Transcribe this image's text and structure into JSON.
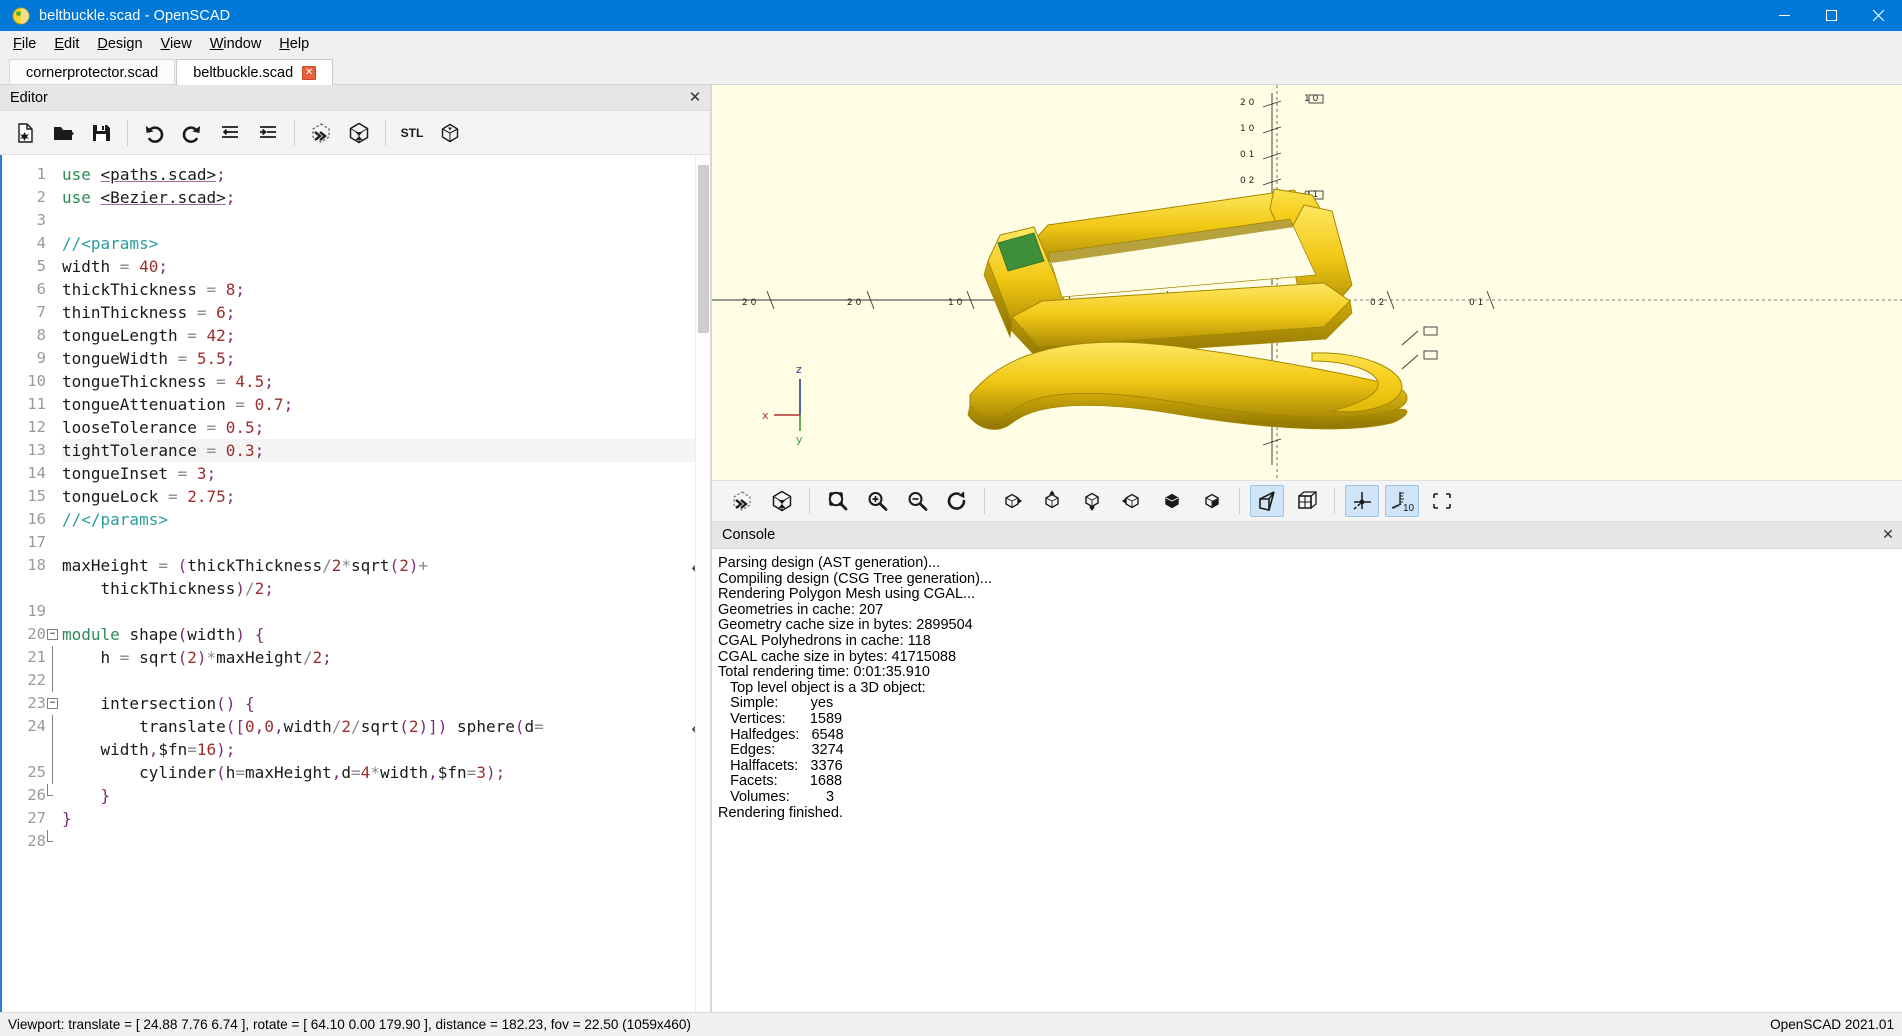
{
  "window": {
    "title": "beltbuckle.scad - OpenSCAD",
    "app_icon": "openscad-logo-icon",
    "titlebar_color": "#0078d7",
    "minimize_label": "Minimize",
    "maximize_label": "Maximize",
    "close_label": "Close"
  },
  "menubar": {
    "items": [
      {
        "label": "File",
        "mnemonic": "F"
      },
      {
        "label": "Edit",
        "mnemonic": "E"
      },
      {
        "label": "Design",
        "mnemonic": "D"
      },
      {
        "label": "View",
        "mnemonic": "V"
      },
      {
        "label": "Window",
        "mnemonic": "W"
      },
      {
        "label": "Help",
        "mnemonic": "H"
      }
    ]
  },
  "doctabs": {
    "tabs": [
      {
        "label": "cornerprotector.scad",
        "active": false,
        "closable": false
      },
      {
        "label": "beltbuckle.scad",
        "active": true,
        "closable": true,
        "close_glyph": "✕"
      }
    ]
  },
  "editor": {
    "dock_title": "Editor",
    "dock_close_glyph": "✕",
    "toolbar": [
      {
        "name": "new-document-button",
        "icon": "new-file-icon",
        "title": "New"
      },
      {
        "name": "open-document-button",
        "icon": "open-folder-icon",
        "title": "Open"
      },
      {
        "name": "save-document-button",
        "icon": "floppy-save-icon",
        "title": "Save"
      },
      {
        "name": "separator-1",
        "icon": "separator",
        "title": ""
      },
      {
        "name": "undo-button",
        "icon": "undo-arrow-icon",
        "title": "Undo"
      },
      {
        "name": "redo-button",
        "icon": "redo-arrow-icon",
        "title": "Redo"
      },
      {
        "name": "unindent-button",
        "icon": "unindent-icon",
        "title": "Unindent"
      },
      {
        "name": "indent-button",
        "icon": "indent-icon",
        "title": "Indent"
      },
      {
        "name": "separator-2",
        "icon": "separator",
        "title": ""
      },
      {
        "name": "preview-button",
        "icon": "preview-fast-icon",
        "title": "Preview"
      },
      {
        "name": "render-button",
        "icon": "render-cube-icon",
        "title": "Render"
      },
      {
        "name": "separator-3",
        "icon": "separator",
        "title": ""
      },
      {
        "name": "export-stl-button",
        "icon": "stl-export-icon",
        "title": "Export as STL",
        "text": "STL"
      },
      {
        "name": "export-amf-button",
        "icon": "amf-export-icon",
        "title": "Export as AMF"
      }
    ],
    "scrollbar": {
      "name": "editor-vertical-scrollbar"
    },
    "current_line": 13,
    "lines": [
      {
        "n": 1,
        "fold": "",
        "tokens": [
          {
            "t": "use",
            "c": "k-use"
          },
          {
            "t": " ",
            "c": "k-id"
          },
          {
            "t": "<paths.scad>",
            "c": "k-inc"
          },
          {
            "t": ";",
            "c": "k-punc"
          }
        ]
      },
      {
        "n": 2,
        "fold": "",
        "tokens": [
          {
            "t": "use",
            "c": "k-use"
          },
          {
            "t": " ",
            "c": "k-id"
          },
          {
            "t": "<Bezier.scad>",
            "c": "k-inc"
          },
          {
            "t": ";",
            "c": "k-punc"
          }
        ]
      },
      {
        "n": 3,
        "fold": "",
        "tokens": []
      },
      {
        "n": 4,
        "fold": "",
        "tokens": [
          {
            "t": "//<params>",
            "c": "k-com"
          }
        ]
      },
      {
        "n": 5,
        "fold": "",
        "tokens": [
          {
            "t": "width ",
            "c": "k-id"
          },
          {
            "t": "= ",
            "c": "k-op"
          },
          {
            "t": "40",
            "c": "k-num"
          },
          {
            "t": ";",
            "c": "k-punc"
          }
        ]
      },
      {
        "n": 6,
        "fold": "",
        "tokens": [
          {
            "t": "thickThickness ",
            "c": "k-id"
          },
          {
            "t": "= ",
            "c": "k-op"
          },
          {
            "t": "8",
            "c": "k-num"
          },
          {
            "t": ";",
            "c": "k-punc"
          }
        ]
      },
      {
        "n": 7,
        "fold": "",
        "tokens": [
          {
            "t": "thinThickness ",
            "c": "k-id"
          },
          {
            "t": "= ",
            "c": "k-op"
          },
          {
            "t": "6",
            "c": "k-num"
          },
          {
            "t": ";",
            "c": "k-punc"
          }
        ]
      },
      {
        "n": 8,
        "fold": "",
        "tokens": [
          {
            "t": "tongueLength ",
            "c": "k-id"
          },
          {
            "t": "= ",
            "c": "k-op"
          },
          {
            "t": "42",
            "c": "k-num"
          },
          {
            "t": ";",
            "c": "k-punc"
          }
        ]
      },
      {
        "n": 9,
        "fold": "",
        "tokens": [
          {
            "t": "tongueWidth ",
            "c": "k-id"
          },
          {
            "t": "= ",
            "c": "k-op"
          },
          {
            "t": "5.5",
            "c": "k-num"
          },
          {
            "t": ";",
            "c": "k-punc"
          }
        ]
      },
      {
        "n": 10,
        "fold": "",
        "tokens": [
          {
            "t": "tongueThickness ",
            "c": "k-id"
          },
          {
            "t": "= ",
            "c": "k-op"
          },
          {
            "t": "4.5",
            "c": "k-num"
          },
          {
            "t": ";",
            "c": "k-punc"
          }
        ]
      },
      {
        "n": 11,
        "fold": "",
        "tokens": [
          {
            "t": "tongueAttenuation ",
            "c": "k-id"
          },
          {
            "t": "= ",
            "c": "k-op"
          },
          {
            "t": "0.7",
            "c": "k-num"
          },
          {
            "t": ";",
            "c": "k-punc"
          }
        ]
      },
      {
        "n": 12,
        "fold": "",
        "tokens": [
          {
            "t": "looseTolerance ",
            "c": "k-id"
          },
          {
            "t": "= ",
            "c": "k-op"
          },
          {
            "t": "0.5",
            "c": "k-num"
          },
          {
            "t": ";",
            "c": "k-punc"
          }
        ]
      },
      {
        "n": 13,
        "fold": "",
        "tokens": [
          {
            "t": "tightTolerance ",
            "c": "k-id"
          },
          {
            "t": "= ",
            "c": "k-op"
          },
          {
            "t": "0.3",
            "c": "k-num"
          },
          {
            "t": ";",
            "c": "k-punc"
          }
        ]
      },
      {
        "n": 14,
        "fold": "",
        "tokens": [
          {
            "t": "tongueInset ",
            "c": "k-id"
          },
          {
            "t": "= ",
            "c": "k-op"
          },
          {
            "t": "3",
            "c": "k-num"
          },
          {
            "t": ";",
            "c": "k-punc"
          }
        ]
      },
      {
        "n": 15,
        "fold": "",
        "tokens": [
          {
            "t": "tongueLock ",
            "c": "k-id"
          },
          {
            "t": "= ",
            "c": "k-op"
          },
          {
            "t": "2.75",
            "c": "k-num"
          },
          {
            "t": ";",
            "c": "k-punc"
          }
        ]
      },
      {
        "n": 16,
        "fold": "",
        "tokens": [
          {
            "t": "//</params>",
            "c": "k-com"
          }
        ]
      },
      {
        "n": 17,
        "fold": "",
        "tokens": []
      },
      {
        "n": 18,
        "fold": "",
        "wrap": true,
        "tokens": [
          {
            "t": "maxHeight ",
            "c": "k-id"
          },
          {
            "t": "= ",
            "c": "k-op"
          },
          {
            "t": "(",
            "c": "k-punc"
          },
          {
            "t": "thickThickness",
            "c": "k-id"
          },
          {
            "t": "/",
            "c": "k-op"
          },
          {
            "t": "2",
            "c": "k-num"
          },
          {
            "t": "*",
            "c": "k-op"
          },
          {
            "t": "sqrt",
            "c": "k-id"
          },
          {
            "t": "(",
            "c": "k-punc"
          },
          {
            "t": "2",
            "c": "k-num"
          },
          {
            "t": ")",
            "c": "k-punc"
          },
          {
            "t": "+",
            "c": "k-op"
          }
        ]
      },
      {
        "n": "",
        "fold": "",
        "cont": true,
        "tokens": [
          {
            "t": "    ",
            "c": "k-id"
          },
          {
            "t": "thickThickness",
            "c": "k-id"
          },
          {
            "t": ")",
            "c": "k-punc"
          },
          {
            "t": "/",
            "c": "k-op"
          },
          {
            "t": "2",
            "c": "k-num"
          },
          {
            "t": ";",
            "c": "k-punc"
          }
        ]
      },
      {
        "n": 19,
        "fold": "",
        "tokens": []
      },
      {
        "n": 20,
        "fold": "minus",
        "tokens": [
          {
            "t": "module",
            "c": "k-kw"
          },
          {
            "t": " ",
            "c": "k-id"
          },
          {
            "t": "shape",
            "c": "k-id"
          },
          {
            "t": "(",
            "c": "k-punc"
          },
          {
            "t": "width",
            "c": "k-id"
          },
          {
            "t": ")",
            "c": "k-punc"
          },
          {
            "t": " ",
            "c": "k-id"
          },
          {
            "t": "{",
            "c": "k-punc"
          }
        ]
      },
      {
        "n": 21,
        "fold": "line",
        "tokens": [
          {
            "t": "    h ",
            "c": "k-id"
          },
          {
            "t": "= ",
            "c": "k-op"
          },
          {
            "t": "sqrt",
            "c": "k-id"
          },
          {
            "t": "(",
            "c": "k-punc"
          },
          {
            "t": "2",
            "c": "k-num"
          },
          {
            "t": ")",
            "c": "k-punc"
          },
          {
            "t": "*",
            "c": "k-op"
          },
          {
            "t": "maxHeight",
            "c": "k-id"
          },
          {
            "t": "/",
            "c": "k-op"
          },
          {
            "t": "2",
            "c": "k-num"
          },
          {
            "t": ";",
            "c": "k-punc"
          }
        ]
      },
      {
        "n": 22,
        "fold": "line",
        "tokens": []
      },
      {
        "n": 23,
        "fold": "minus",
        "tokens": [
          {
            "t": "    ",
            "c": "k-id"
          },
          {
            "t": "intersection",
            "c": "k-id"
          },
          {
            "t": "()",
            "c": "k-punc"
          },
          {
            "t": " ",
            "c": "k-id"
          },
          {
            "t": "{",
            "c": "k-punc"
          }
        ]
      },
      {
        "n": 24,
        "fold": "line",
        "wrap": true,
        "tokens": [
          {
            "t": "        ",
            "c": "k-id"
          },
          {
            "t": "translate",
            "c": "k-id"
          },
          {
            "t": "([",
            "c": "k-punc"
          },
          {
            "t": "0",
            "c": "k-num"
          },
          {
            "t": ",",
            "c": "k-punc"
          },
          {
            "t": "0",
            "c": "k-num"
          },
          {
            "t": ",",
            "c": "k-punc"
          },
          {
            "t": "width",
            "c": "k-id"
          },
          {
            "t": "/",
            "c": "k-op"
          },
          {
            "t": "2",
            "c": "k-num"
          },
          {
            "t": "/",
            "c": "k-op"
          },
          {
            "t": "sqrt",
            "c": "k-id"
          },
          {
            "t": "(",
            "c": "k-punc"
          },
          {
            "t": "2",
            "c": "k-num"
          },
          {
            "t": ")])",
            "c": "k-punc"
          },
          {
            "t": " ",
            "c": "k-id"
          },
          {
            "t": "sphere",
            "c": "k-id"
          },
          {
            "t": "(",
            "c": "k-punc"
          },
          {
            "t": "d",
            "c": "k-id"
          },
          {
            "t": "=",
            "c": "k-op"
          }
        ]
      },
      {
        "n": "",
        "fold": "line",
        "cont": true,
        "tokens": [
          {
            "t": "    width",
            "c": "k-id"
          },
          {
            "t": ",",
            "c": "k-punc"
          },
          {
            "t": "$fn",
            "c": "k-id"
          },
          {
            "t": "=",
            "c": "k-op"
          },
          {
            "t": "16",
            "c": "k-num"
          },
          {
            "t": ");",
            "c": "k-punc"
          }
        ]
      },
      {
        "n": 25,
        "fold": "line",
        "tokens": [
          {
            "t": "        ",
            "c": "k-id"
          },
          {
            "t": "cylinder",
            "c": "k-id"
          },
          {
            "t": "(",
            "c": "k-punc"
          },
          {
            "t": "h",
            "c": "k-id"
          },
          {
            "t": "=",
            "c": "k-op"
          },
          {
            "t": "maxHeight",
            "c": "k-id"
          },
          {
            "t": ",",
            "c": "k-punc"
          },
          {
            "t": "d",
            "c": "k-id"
          },
          {
            "t": "=",
            "c": "k-op"
          },
          {
            "t": "4",
            "c": "k-num"
          },
          {
            "t": "*",
            "c": "k-op"
          },
          {
            "t": "width",
            "c": "k-id"
          },
          {
            "t": ",",
            "c": "k-punc"
          },
          {
            "t": "$fn",
            "c": "k-id"
          },
          {
            "t": "=",
            "c": "k-op"
          },
          {
            "t": "3",
            "c": "k-num"
          },
          {
            "t": ");",
            "c": "k-punc"
          }
        ]
      },
      {
        "n": 26,
        "fold": "end",
        "tokens": [
          {
            "t": "    ",
            "c": "k-id"
          },
          {
            "t": "}",
            "c": "k-punc"
          }
        ]
      },
      {
        "n": 27,
        "fold": "",
        "tokens": [
          {
            "t": "}",
            "c": "k-punc"
          }
        ]
      },
      {
        "n": 28,
        "fold": "end",
        "tokens": []
      }
    ]
  },
  "viewer": {
    "axis_labels": {
      "x": "x",
      "y": "y",
      "z": "z"
    },
    "background_color": "#fffee5",
    "object_color": "#f9d72c",
    "toolbar": [
      {
        "name": "viewer-preview-button",
        "icon": "preview-fast-icon",
        "title": "Preview",
        "active": false
      },
      {
        "name": "viewer-render-button",
        "icon": "render-cube-icon",
        "title": "Render",
        "active": false
      },
      {
        "name": "separator-1",
        "icon": "separator",
        "title": "",
        "active": false
      },
      {
        "name": "zoom-all-button",
        "icon": "zoom-fit-icon",
        "title": "View All",
        "active": false
      },
      {
        "name": "zoom-in-button",
        "icon": "zoom-in-icon",
        "title": "Zoom In",
        "active": false
      },
      {
        "name": "zoom-out-button",
        "icon": "zoom-out-icon",
        "title": "Zoom Out",
        "active": false
      },
      {
        "name": "reset-view-button",
        "icon": "reset-rotate-icon",
        "title": "Reset View",
        "active": false
      },
      {
        "name": "separator-2",
        "icon": "separator",
        "title": "",
        "active": false
      },
      {
        "name": "view-right-button",
        "icon": "cube-right-icon",
        "title": "Right",
        "active": false
      },
      {
        "name": "view-top-button",
        "icon": "cube-top-icon",
        "title": "Top",
        "active": false
      },
      {
        "name": "view-bottom-button",
        "icon": "cube-bottom-icon",
        "title": "Bottom",
        "active": false
      },
      {
        "name": "view-left-button",
        "icon": "cube-left-icon",
        "title": "Left",
        "active": false
      },
      {
        "name": "view-front-button",
        "icon": "cube-front-icon",
        "title": "Front",
        "active": false
      },
      {
        "name": "view-back-button",
        "icon": "cube-back-icon",
        "title": "Back",
        "active": false
      },
      {
        "name": "separator-3",
        "icon": "separator",
        "title": "",
        "active": false
      },
      {
        "name": "perspective-view-button",
        "icon": "perspective-icon",
        "title": "Perspective",
        "active": true
      },
      {
        "name": "orthogonal-view-button",
        "icon": "orthogonal-icon",
        "title": "Orthogonal",
        "active": false
      },
      {
        "name": "separator-4",
        "icon": "separator",
        "title": "",
        "active": false
      },
      {
        "name": "show-axes-button",
        "icon": "axes-icon",
        "title": "Show Axes",
        "active": true
      },
      {
        "name": "show-scale-markers-button",
        "icon": "scale-ruler-icon",
        "title": "Show Scale Markers",
        "active": true,
        "text": "10"
      },
      {
        "name": "show-edges-button",
        "icon": "edges-frame-icon",
        "title": "Show Edges",
        "active": false
      }
    ]
  },
  "console": {
    "title": "Console",
    "close_glyph": "✕",
    "lines": [
      "Parsing design (AST generation)...",
      "Compiling design (CSG Tree generation)...",
      "Rendering Polygon Mesh using CGAL...",
      "Geometries in cache: 207",
      "Geometry cache size in bytes: 2899504",
      "CGAL Polyhedrons in cache: 118",
      "CGAL cache size in bytes: 41715088",
      "Total rendering time: 0:01:35.910",
      "   Top level object is a 3D object:",
      "   Simple:        yes",
      "   Vertices:      1589",
      "   Halfedges:   6548",
      "   Edges:         3274",
      "   Halffacets:   3376",
      "   Facets:        1688",
      "   Volumes:         3",
      "Rendering finished."
    ]
  },
  "statusbar": {
    "viewport_text": "Viewport: translate = [ 24.88 7.76 6.74 ], rotate = [ 64.10 0.00 179.90 ], distance = 182.23, fov = 22.50 (1059x460)",
    "version": "OpenSCAD 2021.01"
  }
}
